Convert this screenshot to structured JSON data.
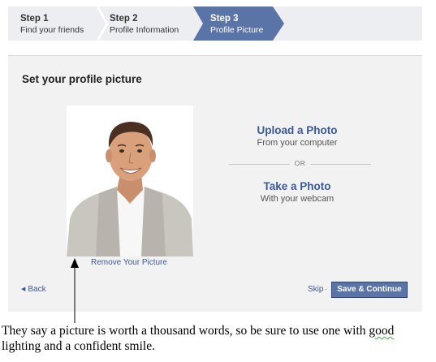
{
  "steps": [
    {
      "number": "Step 1",
      "label": "Find your friends",
      "active": false
    },
    {
      "number": "Step 2",
      "label": "Profile Information",
      "active": false
    },
    {
      "number": "Step 3",
      "label": "Profile Picture",
      "active": true
    }
  ],
  "colors": {
    "accent": "#3b5998",
    "active_step": "#5b74a8",
    "panel_bg": "#f2f2f2",
    "steps_bg": "#edeef2"
  },
  "panel": {
    "title": "Set your profile picture",
    "remove_link": "Remove Your Picture",
    "upload": {
      "title": "Upload a Photo",
      "subtitle": "From your computer"
    },
    "separator": "OR",
    "webcam": {
      "title": "Take a Photo",
      "subtitle": "With your webcam"
    }
  },
  "footer": {
    "back": "Back",
    "skip": "Skip",
    "separator": "·",
    "save": "Save & Continue"
  },
  "caption": {
    "before": "They say a picture is worth a thousand words, so be sure to use one with ",
    "underlined": "good",
    "after": " lighting and a confident smile."
  }
}
